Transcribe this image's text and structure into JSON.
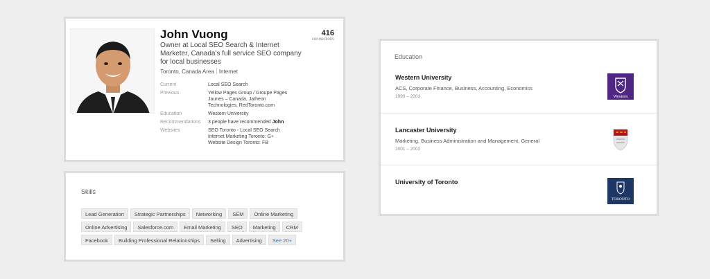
{
  "profile": {
    "name": "John Vuong",
    "connections_count": "416",
    "connections_label": "connections",
    "headline": "Owner at Local SEO Search & Internet Marketer, Canada's full service SEO company for local businesses",
    "location": "Toronto, Canada Area",
    "industry": "Internet",
    "details": {
      "current_label": "Current",
      "current_value": "Local SEO Search",
      "previous_label": "Previous",
      "previous_lines": [
        "Yellow Pages Group / Groupe Pages",
        "Jaunes – Canada, Jatheon",
        "Technologies, RedToronto.com"
      ],
      "education_label": "Education",
      "education_value": "Western University",
      "recommendations_label": "Recommendations",
      "recommendations_text": "3 people have recommended",
      "recommendations_name": "John",
      "websites_label": "Websites",
      "websites_lines": [
        "SEO Toronto - Local SEO Search",
        "Internet Marketing Toronto: G+",
        "Website Design Toronto: FB"
      ]
    }
  },
  "skills": {
    "title": "Skills",
    "rows": [
      [
        "Lead Generation",
        "Strategic Partnerships",
        "Networking",
        "SEM",
        "Online Marketing"
      ],
      [
        "Online Advertising",
        "Salesforce.com",
        "Email Marketing",
        "SEO",
        "Marketing",
        "CRM"
      ],
      [
        "Facebook",
        "Building Professional Relationships",
        "Selling",
        "Advertising"
      ]
    ],
    "see_more": "See 20+"
  },
  "education": {
    "title": "Education",
    "items": [
      {
        "school": "Western University",
        "degree": "ACS, Corporate Finance, Business, Accounting, Economics",
        "years": "1999 – 2003",
        "logo": "western-logo",
        "logo_text": "Western",
        "logo_color": "#4f2683"
      },
      {
        "school": "Lancaster University",
        "degree": "Marketing, Business Administration and Management, General",
        "years": "2001 – 2002",
        "logo": "lancaster-crest",
        "logo_color": "#b5121b"
      },
      {
        "school": "University of Toronto",
        "degree": "",
        "years": "",
        "logo": "toronto-crest",
        "logo_text": "TORONTO",
        "logo_color": "#1e3765"
      }
    ]
  }
}
